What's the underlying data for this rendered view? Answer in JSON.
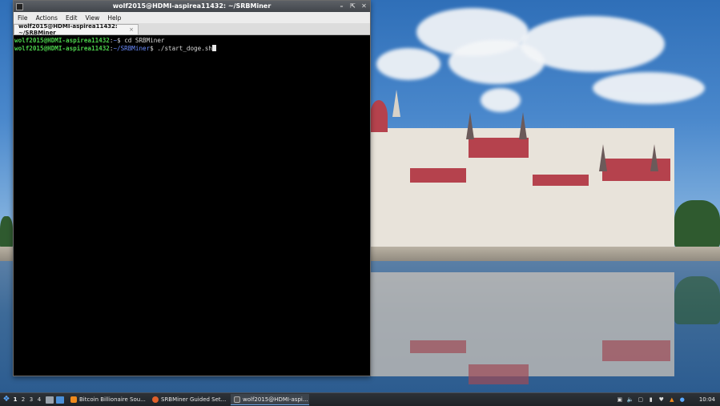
{
  "window": {
    "title": "wolf2015@HDMI-aspirea11432: ~/SRBMiner",
    "controls": [
      "minimize-icon",
      "maximize-icon",
      "close-icon"
    ]
  },
  "menubar": {
    "items": [
      "File",
      "Actions",
      "Edit",
      "View",
      "Help"
    ]
  },
  "tab": {
    "label": "wolf2015@HDMI-aspirea11432: ~/SRBMiner",
    "close": "×"
  },
  "terminal": {
    "lines": [
      {
        "user": "wolf2015@HDMI-aspirea11432",
        "sep": ":",
        "path": "~",
        "prompt": "$ ",
        "cmd": "cd SRBMiner"
      },
      {
        "user": "wolf2015@HDMI-aspirea11432",
        "sep": ":",
        "path": "~/SRBMiner",
        "prompt": "$ ",
        "cmd": "./start_doge.sh"
      }
    ]
  },
  "taskbar": {
    "workspaces": [
      "1",
      "2",
      "3",
      "4"
    ],
    "tasks": [
      {
        "label": "Bitcoin Billionaire Sou...",
        "icon": "vlc-icon",
        "color": "#f08a1c"
      },
      {
        "label": "SRBMiner Guided Set...",
        "icon": "firefox-icon",
        "color": "#e0602a"
      },
      {
        "label": "wolf2015@HDMI-aspi...",
        "icon": "terminal-icon",
        "color": "#555555"
      }
    ],
    "clock": "10:04"
  },
  "colors": {
    "prompt_user": "#4cd14c",
    "prompt_path": "#6b8cff",
    "accent": "#5aa9ff"
  }
}
